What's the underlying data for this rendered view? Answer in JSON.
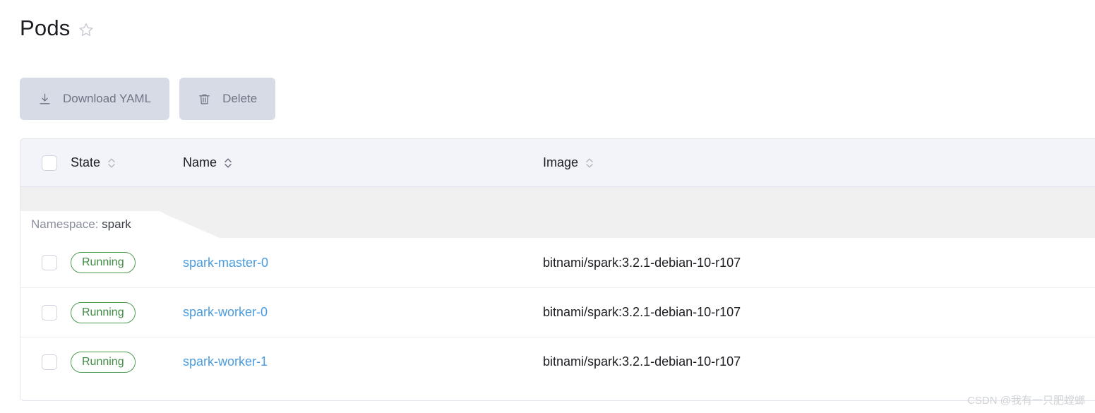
{
  "header": {
    "title": "Pods",
    "favorite_icon": "star-outline-icon"
  },
  "toolbar": {
    "buttons": [
      {
        "label": "Download YAML",
        "icon": "download-icon",
        "enabled": false
      },
      {
        "label": "Delete",
        "icon": "trash-icon",
        "enabled": false
      }
    ]
  },
  "table": {
    "select_all_checkbox": false,
    "columns": [
      {
        "key": "state",
        "label": "State",
        "sortable": true,
        "sort_icon": "sort-chevrons-icon"
      },
      {
        "key": "name",
        "label": "Name",
        "sortable": true,
        "sort_icon": "sort-chevrons-icon"
      },
      {
        "key": "image",
        "label": "Image",
        "sortable": true,
        "sort_icon": "sort-chevrons-icon"
      }
    ],
    "group": {
      "label_prefix": "Namespace:",
      "label_value": "spark"
    },
    "rows": [
      {
        "selected": false,
        "state": "Running",
        "name": "spark-master-0",
        "image": "bitnami/spark:3.2.1-debian-10-r107"
      },
      {
        "selected": false,
        "state": "Running",
        "name": "spark-worker-0",
        "image": "bitnami/spark:3.2.1-debian-10-r107"
      },
      {
        "selected": false,
        "state": "Running",
        "name": "spark-worker-1",
        "image": "bitnami/spark:3.2.1-debian-10-r107"
      }
    ]
  },
  "watermark": {
    "text": "CSDN @我有一只肥螳螂"
  },
  "colors": {
    "accent_link": "#4a9ce0",
    "status_running": "#3f8b43",
    "button_bg": "#d7dbe6",
    "button_text": "#6f7585",
    "header_bg": "#f3f4f9",
    "group_band_bg": "#f0f0f0"
  }
}
